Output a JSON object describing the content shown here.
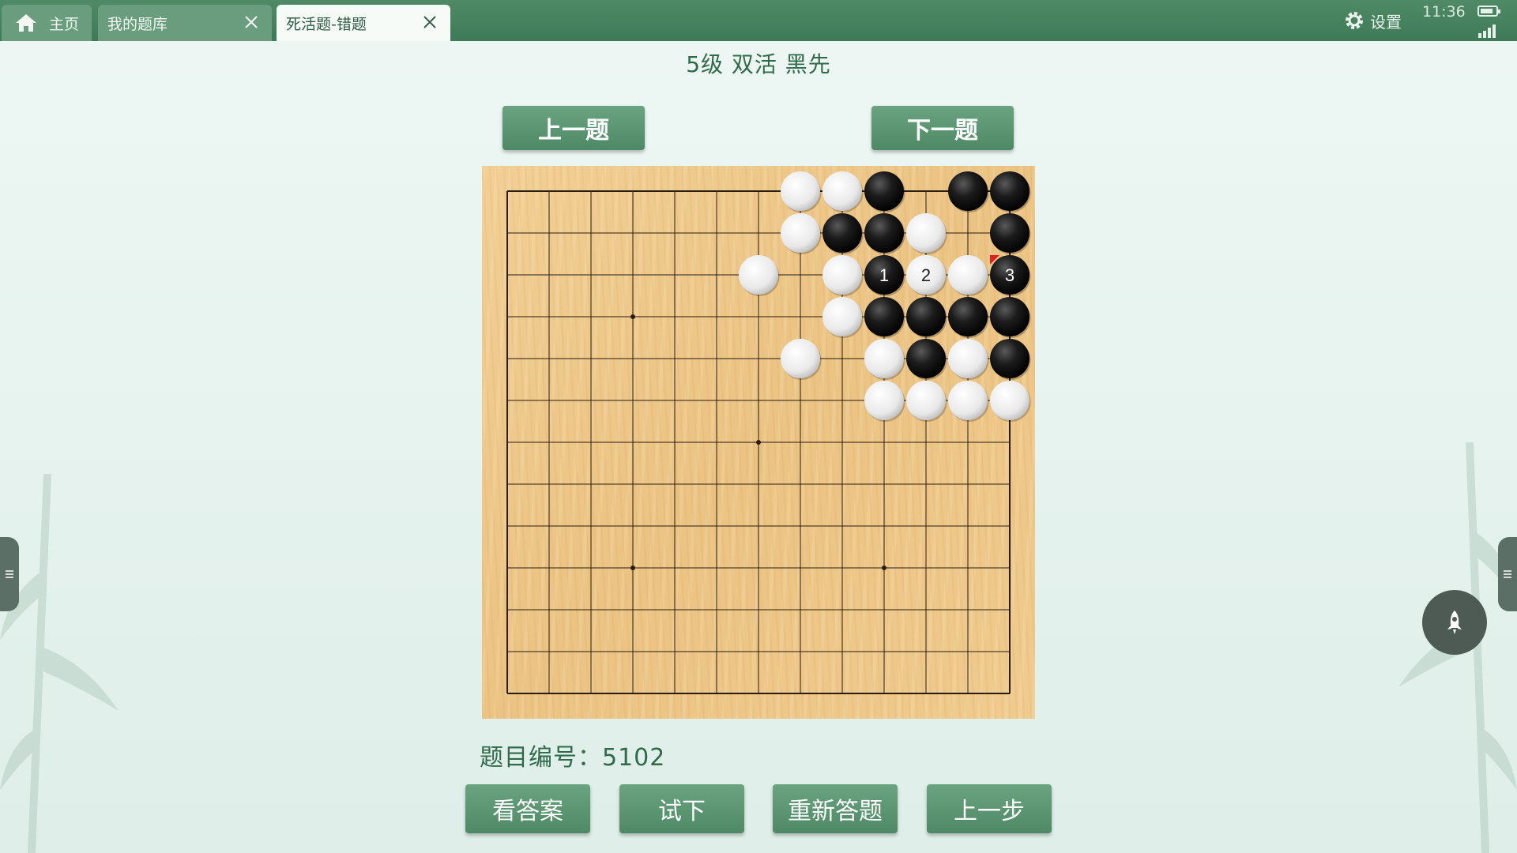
{
  "tabs": {
    "home_label": "主页",
    "library_label": "我的题库",
    "active_label": "死活题-错题"
  },
  "status": {
    "settings_label": "设置",
    "time": "11:36",
    "battery_level": 0.85
  },
  "problem": {
    "title": "5级 双活 黑先",
    "prev_label": "上一题",
    "next_label": "下一题",
    "id_label": "题目编号：",
    "id_value": "5102"
  },
  "board": {
    "size": 13,
    "black_stones": [
      [
        9,
        0
      ],
      [
        11,
        0
      ],
      [
        12,
        0
      ],
      [
        8,
        1
      ],
      [
        9,
        1
      ],
      [
        12,
        1
      ],
      [
        9,
        2
      ],
      [
        12,
        2
      ],
      [
        9,
        3
      ],
      [
        10,
        3
      ],
      [
        11,
        3
      ],
      [
        12,
        3
      ],
      [
        10,
        4
      ],
      [
        12,
        4
      ]
    ],
    "white_stones": [
      [
        7,
        0
      ],
      [
        8,
        0
      ],
      [
        7,
        1
      ],
      [
        10,
        1
      ],
      [
        6,
        2
      ],
      [
        8,
        2
      ],
      [
        10,
        2
      ],
      [
        11,
        2
      ],
      [
        8,
        3
      ],
      [
        7,
        4
      ],
      [
        9,
        4
      ],
      [
        11,
        4
      ],
      [
        9,
        5
      ],
      [
        10,
        5
      ],
      [
        11,
        5
      ],
      [
        12,
        5
      ]
    ],
    "move_labels": [
      {
        "point": [
          9,
          2
        ],
        "label": "1",
        "color": "black"
      },
      {
        "point": [
          10,
          2
        ],
        "label": "2",
        "color": "white"
      },
      {
        "point": [
          12,
          2
        ],
        "label": "3",
        "color": "black"
      }
    ],
    "last_move": [
      12,
      2
    ],
    "last_move_marker_color": "#e02020"
  },
  "actions": {
    "answer_label": "看答案",
    "try_label": "试下",
    "restart_label": "重新答题",
    "undo_label": "上一步"
  },
  "colors": {
    "accent": "#4e8966",
    "topbar": "#3f7a58",
    "title_text": "#2f6a4a"
  }
}
